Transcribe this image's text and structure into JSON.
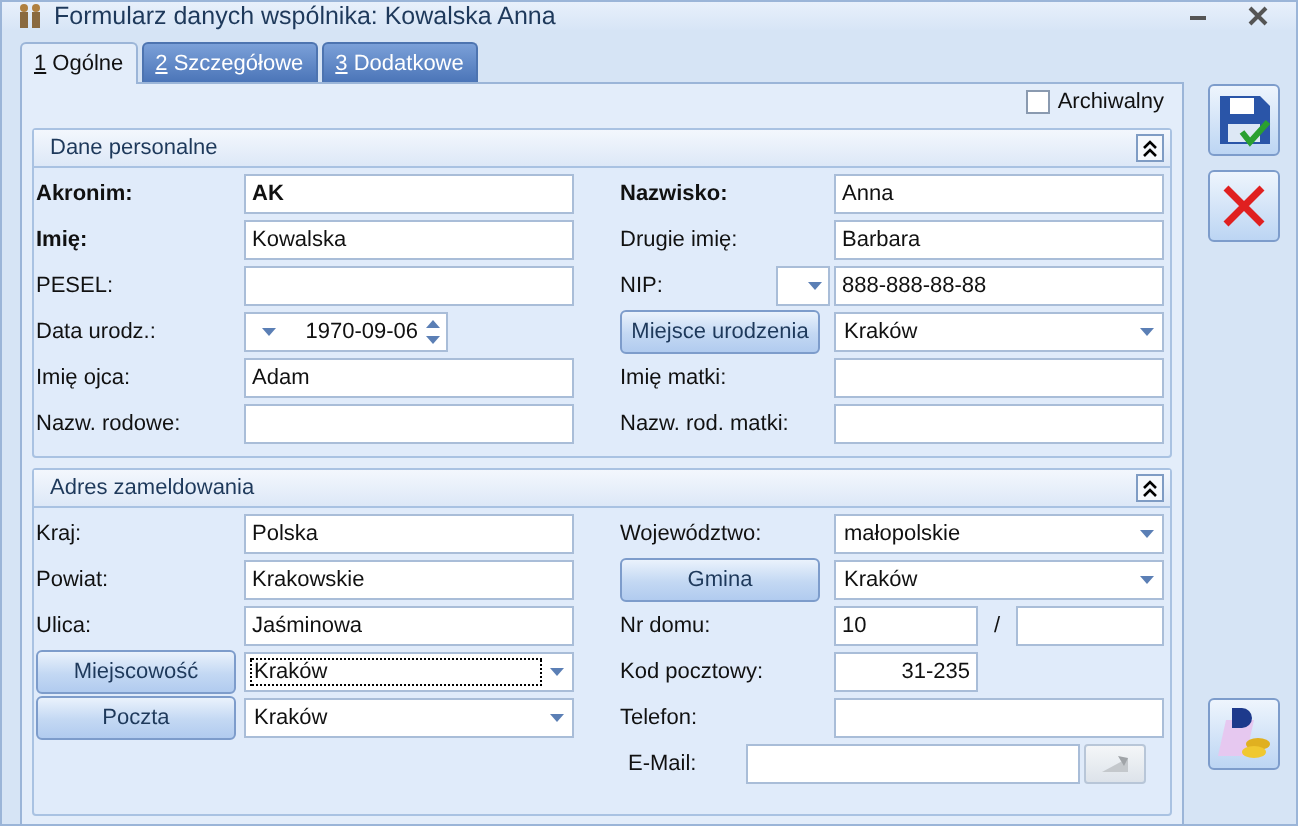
{
  "window": {
    "title": "Formularz danych wspólnika: Kowalska Anna"
  },
  "tabs": [
    {
      "hotkey": "1",
      "label": "Ogólne",
      "selected": true
    },
    {
      "hotkey": "2",
      "label": "Szczegółowe",
      "selected": false
    },
    {
      "hotkey": "3",
      "label": "Dodatkowe",
      "selected": false
    }
  ],
  "archive": {
    "label": "Archiwalny",
    "checked": false
  },
  "sections": [
    {
      "title": "Dane personalne",
      "expanded": true,
      "left": [
        {
          "kind": "field",
          "label": "Akronim:",
          "value": "AK",
          "bold": true,
          "value_bold": true
        },
        {
          "kind": "field",
          "label": "Imię:",
          "value": "Kowalska",
          "bold": true,
          "value_bold": false
        },
        {
          "kind": "field",
          "label": "PESEL:",
          "bold": false,
          "value_bold": false
        },
        {
          "kind": "date",
          "label": "Data urodz.:",
          "value": "1970-09-06"
        },
        {
          "kind": "field",
          "label": "Imię ojca:",
          "value": "Adam",
          "bold": false,
          "value_bold": false
        },
        {
          "kind": "field",
          "label": "Nazw. rodowe:",
          "bold": false,
          "value_bold": false
        }
      ],
      "right": [
        {
          "kind": "field",
          "label": "Nazwisko:",
          "value": "Anna",
          "bold": true,
          "value_bold": false
        },
        {
          "kind": "field",
          "label": "Drugie imię:",
          "value": "Barbara",
          "bold": false,
          "value_bold": false
        },
        {
          "kind": "nip",
          "label": "NIP:",
          "value": "888-888-88-88"
        },
        {
          "kind": "button-combo",
          "button": "Miejsce urodzenia",
          "value": "Kraków",
          "focused": false
        },
        {
          "kind": "field",
          "label": "Imię matki:",
          "bold": false,
          "value_bold": false
        },
        {
          "kind": "field",
          "label": "Nazw. rod. matki:",
          "bold": false,
          "value_bold": false
        }
      ]
    },
    {
      "title": "Adres zameldowania",
      "expanded": true,
      "left": [
        {
          "kind": "field",
          "label": "Kraj:",
          "value": "Polska",
          "bold": false,
          "value_bold": false
        },
        {
          "kind": "field",
          "label": "Powiat:",
          "value": "Krakowskie",
          "bold": false,
          "value_bold": false
        },
        {
          "kind": "field",
          "label": "Ulica:",
          "value": "Jaśminowa",
          "bold": false,
          "value_bold": false
        },
        {
          "kind": "button-combo",
          "button": "Miejscowość",
          "value": "Kraków",
          "focused": true
        },
        {
          "kind": "button-combo",
          "button": "Poczta",
          "value": "Kraków",
          "focused": false
        }
      ],
      "right": [
        {
          "kind": "combo",
          "label": "Województwo:",
          "value": "małopolskie",
          "focused": false
        },
        {
          "kind": "button-combo",
          "button": "Gmina",
          "value": "Kraków",
          "focused": false
        },
        {
          "kind": "house",
          "label": "Nr domu:",
          "value": "10",
          "separator": "/"
        },
        {
          "kind": "postcode",
          "label": "Kod pocztowy:",
          "value": "31-235"
        },
        {
          "kind": "field",
          "label": "Telefon:",
          "bold": false,
          "value_bold": false
        },
        {
          "kind": "email",
          "label": "E-Mail:"
        }
      ]
    }
  ]
}
